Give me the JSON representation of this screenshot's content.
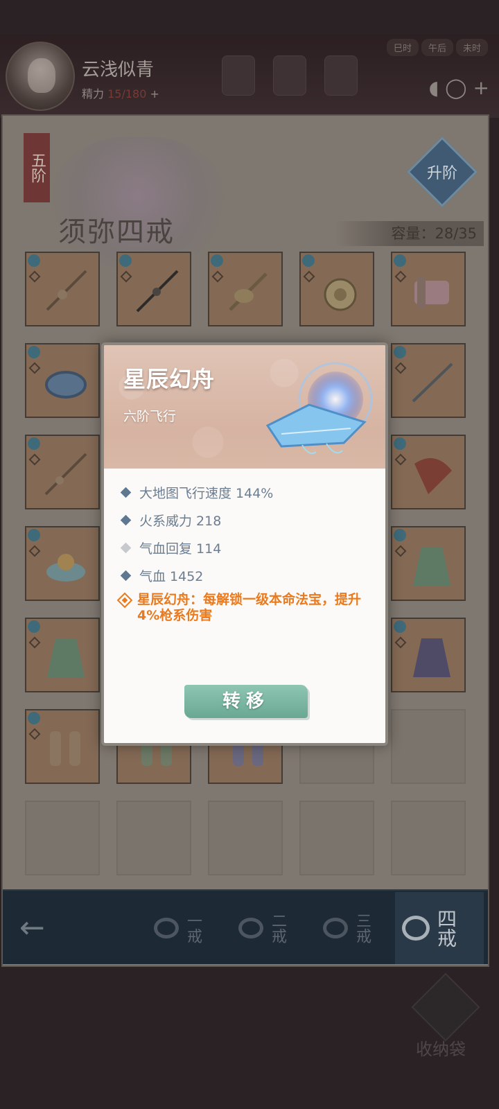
{
  "header": {
    "player_name": "云浅似青",
    "energy_label": "精力",
    "energy_value": "15/180",
    "energy_plus": "+",
    "time_tabs": [
      "巳时",
      "午后",
      "未时"
    ]
  },
  "ring_panel": {
    "grade_tag": "五阶",
    "title": "须弥四戒",
    "upgrade_label": "升阶",
    "capacity_label": "容量：",
    "capacity_value": "28/35"
  },
  "bottom_tabs": [
    {
      "label": "一戒",
      "active": false
    },
    {
      "label": "二戒",
      "active": false
    },
    {
      "label": "三戒",
      "active": false
    },
    {
      "label": "四戒",
      "active": true
    }
  ],
  "storage_bag_label": "收纳袋",
  "modal": {
    "name": "星辰幻舟",
    "type": "六阶飞行",
    "stats": [
      {
        "text": "大地图飞行速度 144%",
        "marker": "blue"
      },
      {
        "text": "火系威力 218",
        "marker": "blue"
      },
      {
        "text": "气血回复 114",
        "marker": "grey"
      },
      {
        "text": "气血 1452",
        "marker": "blue"
      }
    ],
    "skill_text": "星辰幻舟：每解锁一级本命法宝，提升4%枪系伤害",
    "transfer_label": "转移"
  },
  "colors": {
    "accent_orange": "#ea7a1d",
    "stat_text": "#6b7d91",
    "button_teal": "#7db8a2"
  }
}
